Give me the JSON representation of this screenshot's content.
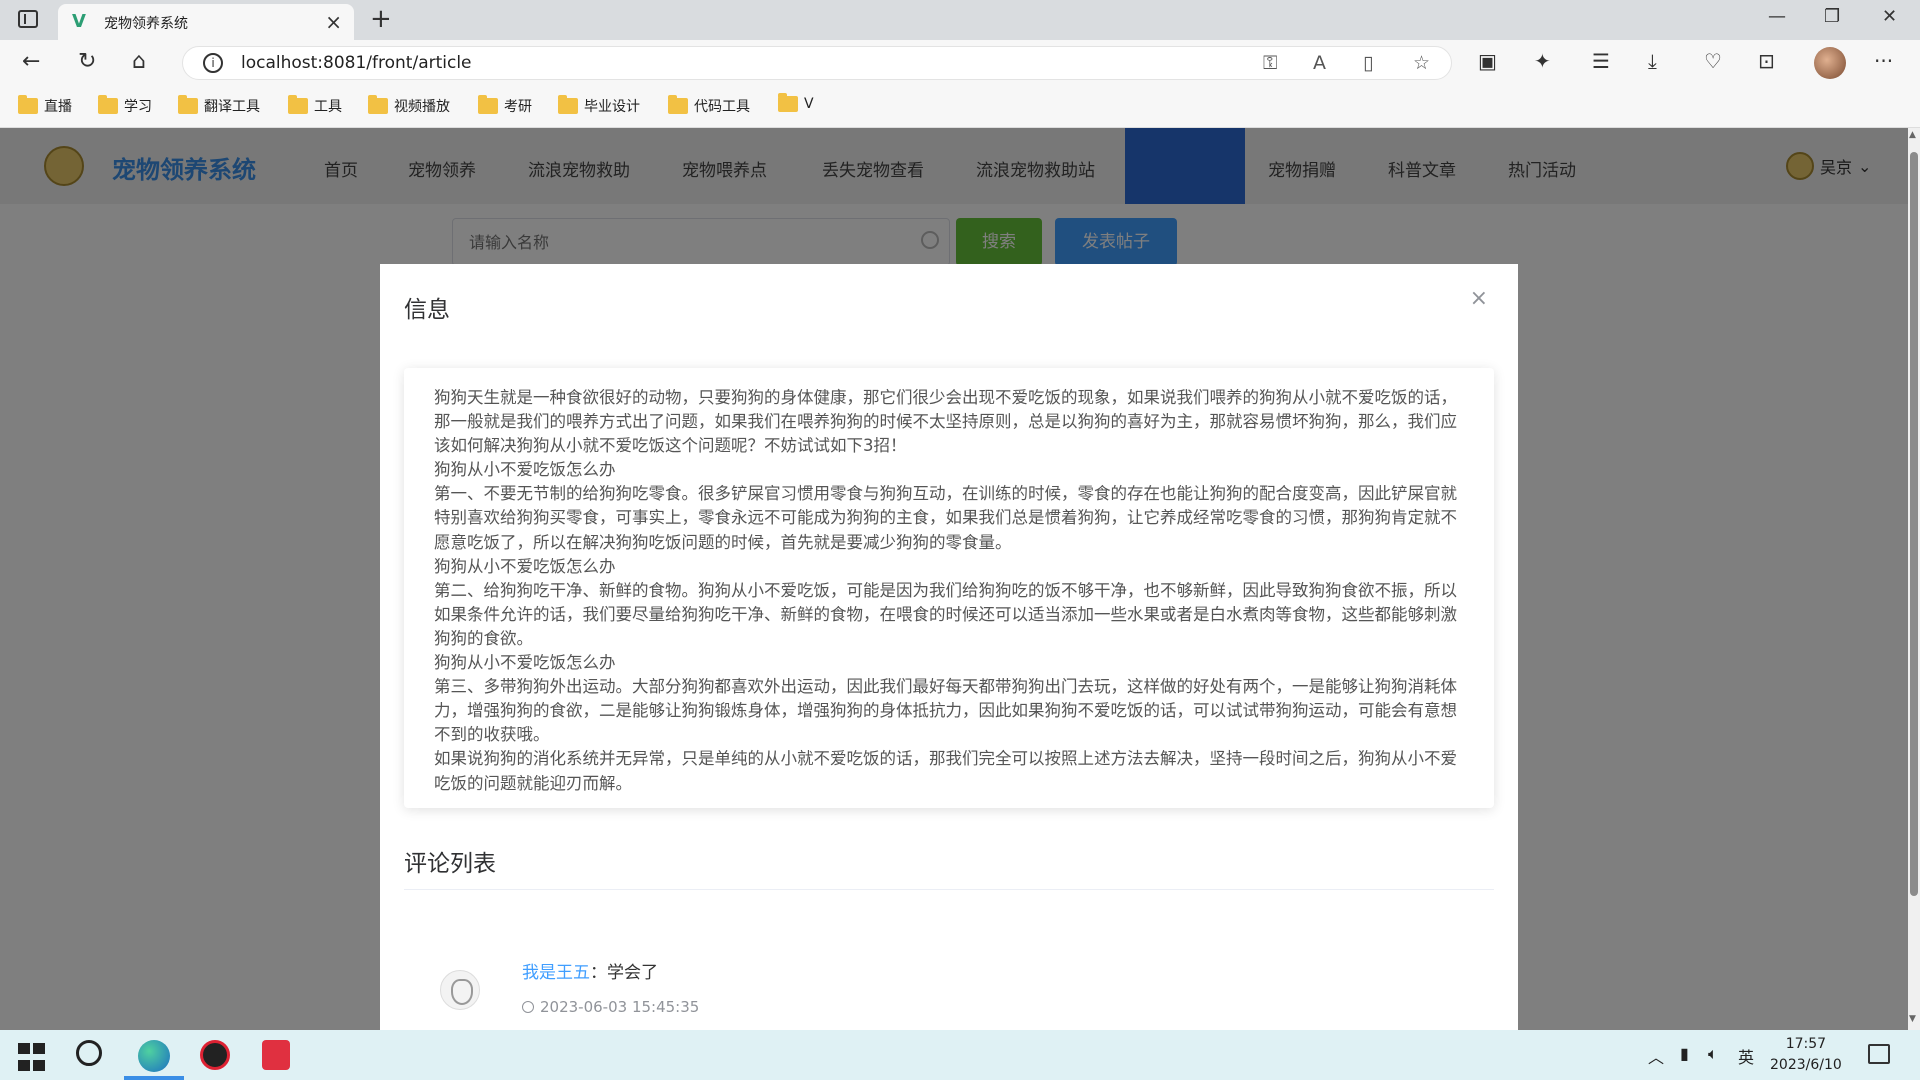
{
  "browser": {
    "tab_title": "宠物领养系统",
    "url": "localhost:8081/front/article",
    "bookmarks": [
      "直播",
      "学习",
      "翻译工具",
      "工具",
      "视频播放",
      "考研",
      "毕业设计",
      "代码工具",
      "V"
    ]
  },
  "site": {
    "logo_text": "宠物领养系统",
    "menu": [
      "首页",
      "宠物领养",
      "流浪宠物救助",
      "宠物喂养点",
      "丢失宠物查看",
      "流浪宠物救助站",
      "",
      "宠物捐赠",
      "科普文章",
      "热门活动"
    ],
    "user_name": "吴京",
    "search_placeholder": "请输入名称",
    "search_button": "搜索",
    "post_button": "发表帖子"
  },
  "modal": {
    "title": "信息",
    "close_label": "×",
    "article_paragraphs": [
      "狗狗天生就是一种食欲很好的动物，只要狗狗的身体健康，那它们很少会出现不爱吃饭的现象，如果说我们喂养的狗狗从小就不爱吃饭的话，那一般就是我们的喂养方式出了问题，如果我们在喂养狗狗的时候不太坚持原则，总是以狗狗的喜好为主，那就容易惯坏狗狗，那么，我们应该如何解决狗狗从小就不爱吃饭这个问题呢？不妨试试如下3招！",
      "狗狗从小不爱吃饭怎么办",
      "第一、不要无节制的给狗狗吃零食。很多铲屎官习惯用零食与狗狗互动，在训练的时候，零食的存在也能让狗狗的配合度变高，因此铲屎官就特别喜欢给狗狗买零食，可事实上，零食永远不可能成为狗狗的主食，如果我们总是惯着狗狗，让它养成经常吃零食的习惯，那狗狗肯定就不愿意吃饭了，所以在解决狗狗吃饭问题的时候，首先就是要减少狗狗的零食量。",
      "狗狗从小不爱吃饭怎么办",
      "第二、给狗狗吃干净、新鲜的食物。狗狗从小不爱吃饭，可能是因为我们给狗狗吃的饭不够干净，也不够新鲜，因此导致狗狗食欲不振，所以如果条件允许的话，我们要尽量给狗狗吃干净、新鲜的食物，在喂食的时候还可以适当添加一些水果或者是白水煮肉等食物，这些都能够刺激狗狗的食欲。",
      "狗狗从小不爱吃饭怎么办",
      "第三、多带狗狗外出运动。大部分狗狗都喜欢外出运动，因此我们最好每天都带狗狗出门去玩，这样做的好处有两个，一是能够让狗狗消耗体力，增强狗狗的食欲，二是能够让狗狗锻炼身体，增强狗狗的身体抵抗力，因此如果狗狗不爱吃饭的话，可以试试带狗狗运动，可能会有意想不到的收获哦。",
      "如果说狗狗的消化系统并无异常，只是单纯的从小就不爱吃饭的话，那我们完全可以按照上述方法去解决，坚持一段时间之后，狗狗从小不爱吃饭的问题就能迎刃而解。"
    ],
    "comments_title": "评论列表",
    "comments": [
      {
        "user": "我是王五",
        "text": "学会了",
        "time": "2023-06-03 15:45:35"
      }
    ]
  },
  "taskbar": {
    "ime": "英",
    "time": "17:57",
    "date": "2023/6/10"
  }
}
